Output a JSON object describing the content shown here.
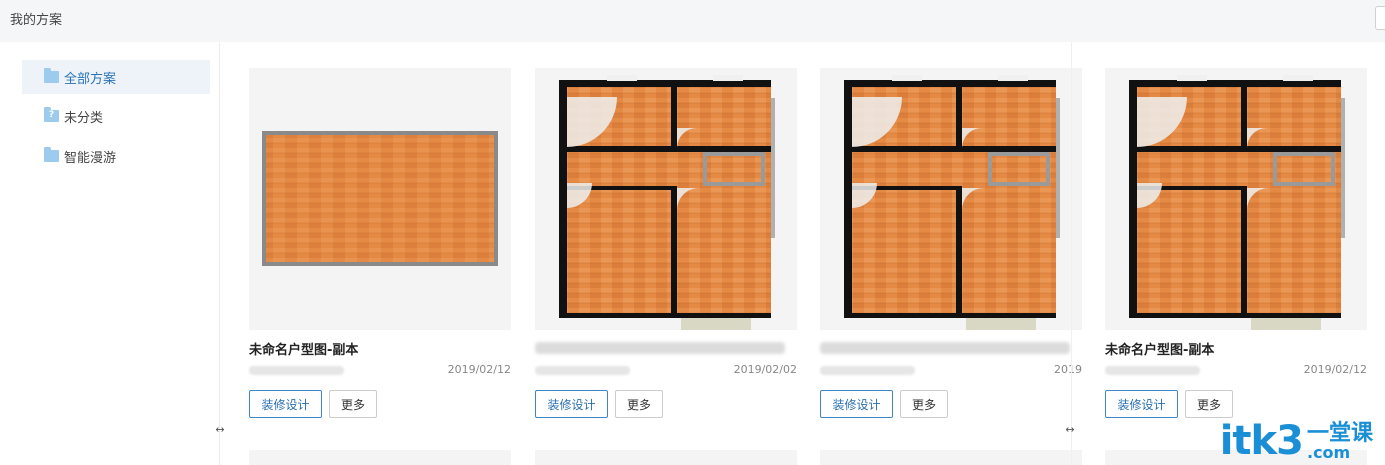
{
  "header": {
    "title": "我的方案"
  },
  "sidebar": {
    "items": [
      {
        "label": "全部方案",
        "active": true
      },
      {
        "label": "未分类"
      },
      {
        "label": "智能漫游"
      }
    ]
  },
  "cards": [
    {
      "title": "未命名户型图-副本",
      "date": "2019/02/12",
      "primary_label": "装修设计",
      "more_label": "更多"
    },
    {
      "title": "",
      "date": "2019/02/02",
      "primary_label": "装修设计",
      "more_label": "更多"
    },
    {
      "title": "",
      "date": "2019",
      "primary_label": "装修设计",
      "more_label": "更多"
    },
    {
      "title": "未命名户型图-副本",
      "date": "2019/02/12",
      "primary_label": "装修设计",
      "more_label": "更多"
    }
  ],
  "resize_glyph": "↔",
  "watermark": {
    "main": "itk3",
    "cn": "一堂课",
    "domain": ".com"
  },
  "colors": {
    "accent": "#2a74b7",
    "floor": "#e58a45",
    "wall": "#111111"
  }
}
